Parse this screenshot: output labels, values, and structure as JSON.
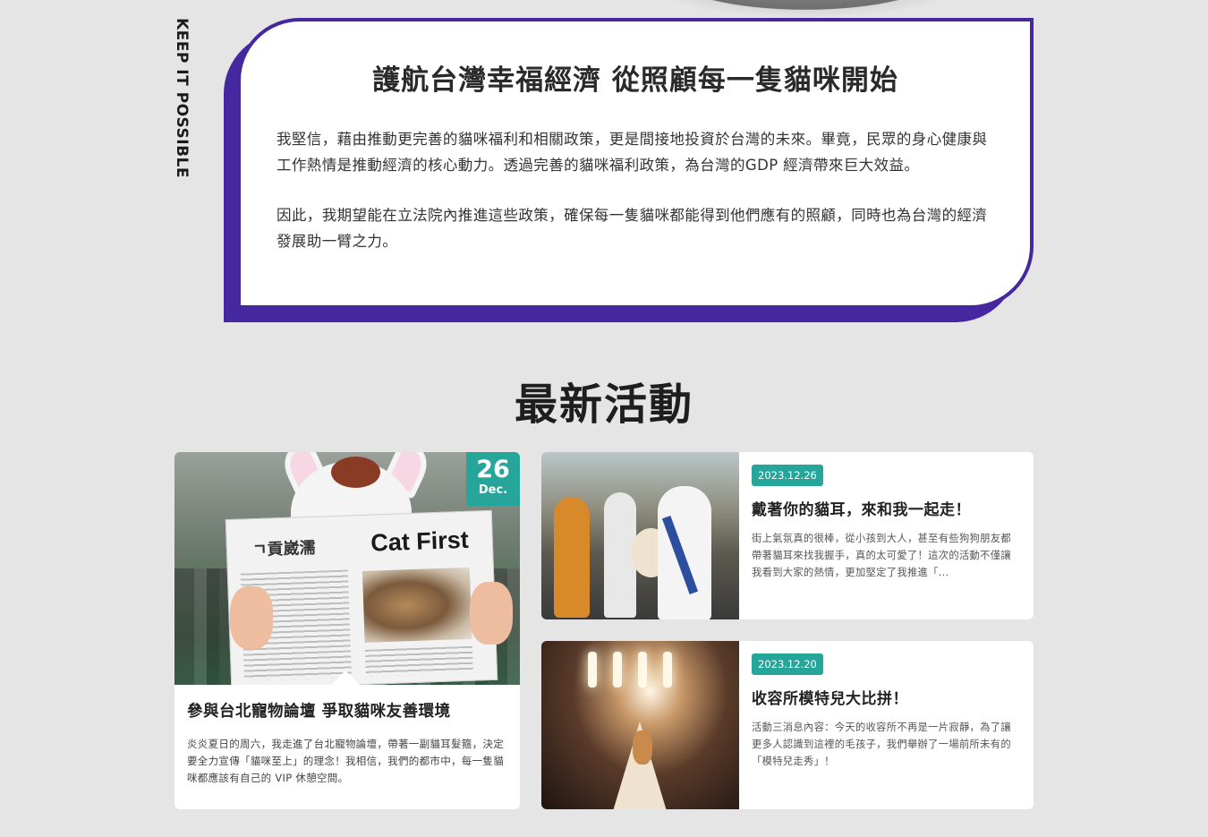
{
  "sidebar": {
    "vertical_label": "KEEP IT POSSIBLE"
  },
  "mission": {
    "title": "護航台灣幸福經濟 從照顧每一隻貓咪開始",
    "paragraph1": "我堅信，藉由推動更完善的貓咪福利和相關政策，更是間接地投資於台灣的未來。畢竟，民眾的身心健康與工作熱情是推動經濟的核心動力。透過完善的貓咪福利政策，為台灣的GDP 經濟帶來巨大效益。",
    "paragraph2": "因此，我期望能在立法院內推進這些政策，確保每一隻貓咪都能得到他們應有的照顧，同時也為台灣的經濟發展助一臂之力。"
  },
  "news": {
    "section_title": "最新活動",
    "featured": {
      "date_day": "26",
      "date_month": "Dec.",
      "image_newspaper_title": "Cat First",
      "image_newspaper_masthead": "ㄱ貢崴濡",
      "title": "參與台北寵物論壇 爭取貓咪友善環境",
      "excerpt": "炎炎夏日的周六，我走進了台北寵物論壇，帶著一副貓耳髮箍，決定要全力宣傳「貓咪至上」的理念！我相信，我們的都市中，每一隻貓咪都應該有自己的 VIP 休憩空間。"
    },
    "items": [
      {
        "date": "2023.12.26",
        "title": "戴著你的貓耳，來和我一起走！",
        "excerpt": "街上氣氛真的很棒，從小孩到大人，甚至有些狗狗朋友都帶著貓耳來找我握手，真的太可愛了！這次的活動不僅讓我看到大家的熱情，更加堅定了我推進「..."
      },
      {
        "date": "2023.12.20",
        "title": "收容所模特兒大比拼！",
        "excerpt": "活動三消息內容：今天的收容所不再是一片寂靜，為了讓更多人認識到這裡的毛孩子，我們舉辦了一場前所未有的「模特兒走秀」！"
      }
    ]
  },
  "colors": {
    "accent_purple": "#4527a0",
    "accent_teal": "#26a69a"
  }
}
